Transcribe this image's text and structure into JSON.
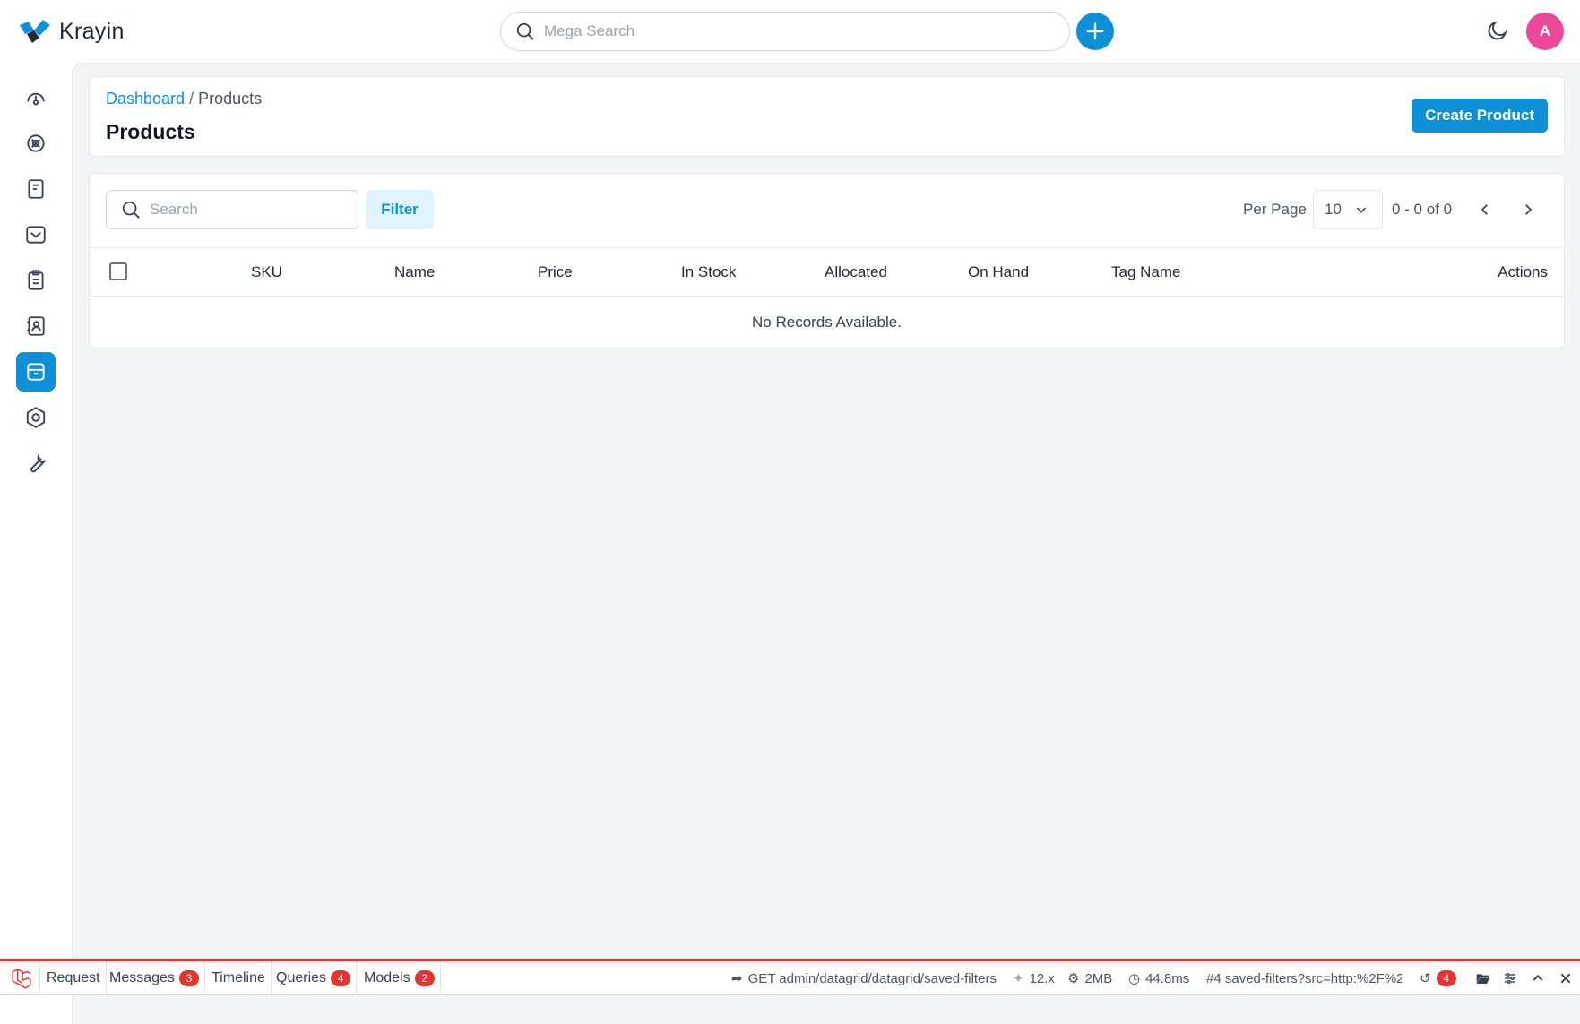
{
  "app": {
    "name": "Krayin"
  },
  "header": {
    "search_placeholder": "Mega Search",
    "avatar_initial": "A"
  },
  "sidebar": {
    "items": [
      {
        "name": "dashboard-icon"
      },
      {
        "name": "leads-icon"
      },
      {
        "name": "quotes-icon"
      },
      {
        "name": "mail-icon"
      },
      {
        "name": "activities-icon"
      },
      {
        "name": "contacts-icon"
      },
      {
        "name": "products-icon",
        "active": true
      },
      {
        "name": "settings-icon"
      },
      {
        "name": "configuration-icon"
      }
    ]
  },
  "page": {
    "breadcrumb": {
      "link": "Dashboard",
      "separator": "/",
      "current": "Products"
    },
    "title": "Products",
    "create_button": "Create Product"
  },
  "grid": {
    "search_placeholder": "Search",
    "filter_label": "Filter",
    "per_page_label": "Per Page",
    "per_page_value": "10",
    "range": "0 - 0 of 0",
    "columns": [
      "SKU",
      "Name",
      "Price",
      "In Stock",
      "Allocated",
      "On Hand",
      "Tag Name",
      "Actions"
    ],
    "empty_message": "No Records Available."
  },
  "debugbar": {
    "tabs": [
      {
        "label": "Request",
        "count": null
      },
      {
        "label": "Messages",
        "count": "3"
      },
      {
        "label": "Timeline",
        "count": null
      },
      {
        "label": "Queries",
        "count": "4"
      },
      {
        "label": "Models",
        "count": "2"
      }
    ],
    "route": "GET admin/datagrid/datagrid/saved-filters",
    "version": "12.x",
    "memory": "2MB",
    "time": "44.8ms",
    "request": "#4 saved-filters?src=http:%2F%2",
    "history_count": "4"
  },
  "colors": {
    "accent": "#0e90d9",
    "avatar": "#ec4899",
    "debug_red": "#e3342f"
  }
}
